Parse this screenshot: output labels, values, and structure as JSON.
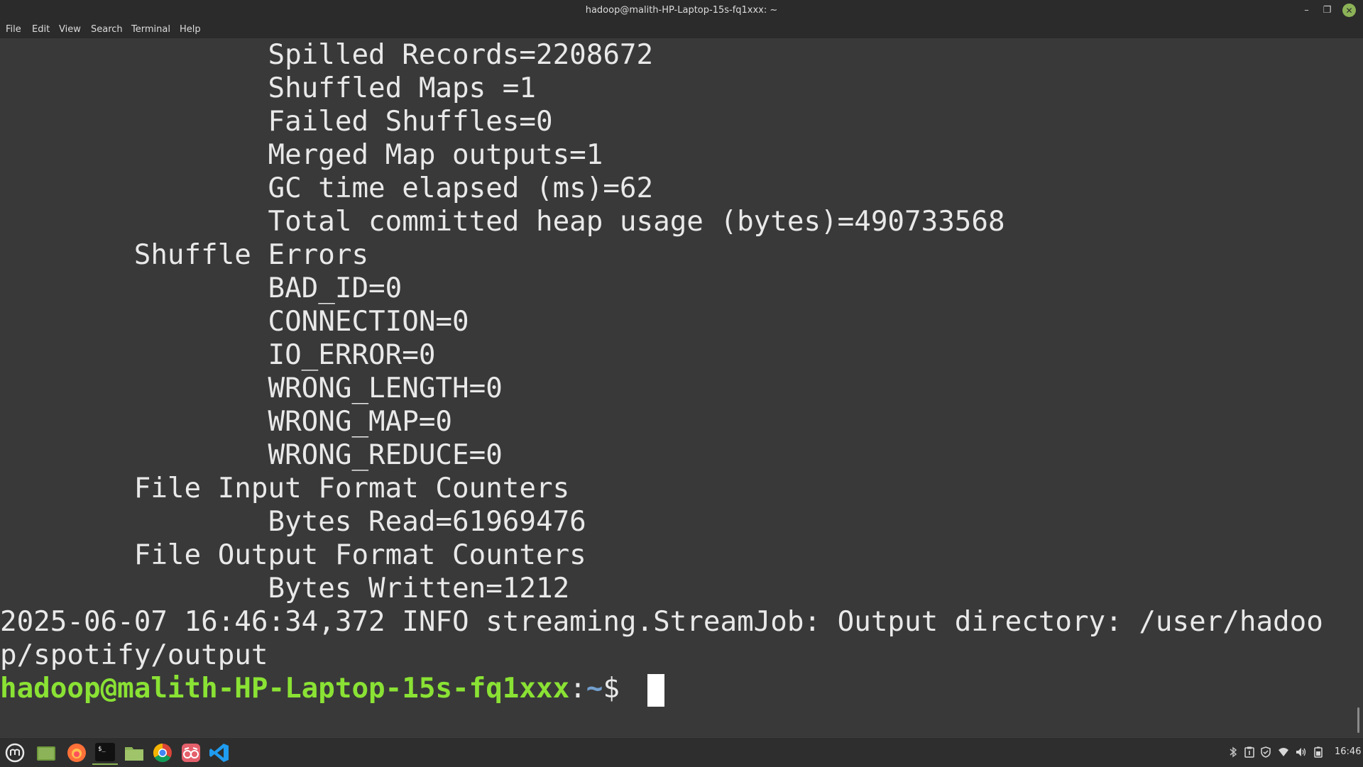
{
  "window": {
    "title": "hadoop@malith-HP-Laptop-15s-fq1xxx: ~",
    "minimize_glyph": "–",
    "maximize_glyph": "❐",
    "close_glyph": "✕"
  },
  "menu": {
    "file": "File",
    "edit": "Edit",
    "view": "View",
    "search": "Search",
    "terminal": "Terminal",
    "help": "Help"
  },
  "terminal": {
    "lines": [
      "                Spilled Records=2208672",
      "                Shuffled Maps =1",
      "                Failed Shuffles=0",
      "                Merged Map outputs=1",
      "                GC time elapsed (ms)=62",
      "                Total committed heap usage (bytes)=490733568",
      "        Shuffle Errors",
      "                BAD_ID=0",
      "                CONNECTION=0",
      "                IO_ERROR=0",
      "                WRONG_LENGTH=0",
      "                WRONG_MAP=0",
      "                WRONG_REDUCE=0",
      "        File Input Format Counters",
      "                Bytes Read=61969476",
      "        File Output Format Counters",
      "                Bytes Written=1212",
      "2025-06-07 16:46:34,372 INFO streaming.StreamJob: Output directory: /user/hadoo",
      "p/spotify/output"
    ],
    "prompt": {
      "user_host": "hadoop@malith-HP-Laptop-15s-fq1xxx",
      "separator": ":",
      "path": "~",
      "symbol": "$ "
    }
  },
  "taskbar": {
    "apps": [
      {
        "name": "mint-menu-icon",
        "active": false
      },
      {
        "name": "show-desktop-icon",
        "active": false
      },
      {
        "name": "firefox-icon",
        "active": false
      },
      {
        "name": "terminal-icon",
        "active": true
      },
      {
        "name": "files-icon",
        "active": false
      },
      {
        "name": "chrome-icon",
        "active": false
      },
      {
        "name": "reader-icon",
        "active": false
      },
      {
        "name": "vscode-icon",
        "active": false
      }
    ],
    "tray": [
      "bluetooth-icon",
      "clipboard-icon",
      "shield-icon",
      "wifi-icon",
      "volume-icon",
      "battery-icon"
    ],
    "clock": "16:46"
  },
  "colors": {
    "terminal_bg": "#393939",
    "terminal_fg": "#e9e9e9",
    "prompt_user": "#8ae234",
    "prompt_path": "#729fcf",
    "accent": "#8cb357"
  }
}
